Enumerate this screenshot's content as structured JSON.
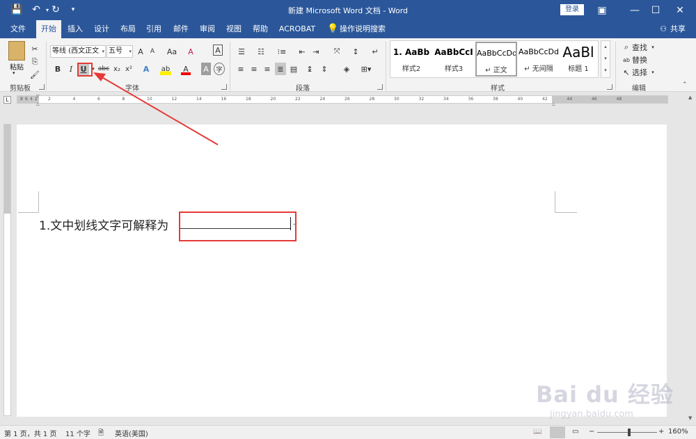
{
  "window": {
    "title": "新建 Microsoft Word 文档  -  Word",
    "login": "登录"
  },
  "tabs": [
    "文件",
    "开始",
    "插入",
    "设计",
    "布局",
    "引用",
    "邮件",
    "审阅",
    "视图",
    "帮助",
    "ACROBAT"
  ],
  "tellme": "操作说明搜索",
  "share": "共享",
  "clipboard": {
    "paste": "粘贴",
    "label": "剪贴板"
  },
  "font": {
    "name": "等线 (西文正文",
    "size": "五号",
    "label": "字体",
    "aa": "Aa",
    "grow": "A",
    "shrink": "A",
    "clear": "A",
    "bold": "B",
    "italic": "I",
    "underline": "U",
    "strike": "abc",
    "sub": "x₂",
    "sup": "x²",
    "effects": "A",
    "highlight": "ab",
    "color": "A",
    "shade": "A",
    "circle": "字"
  },
  "paragraph": {
    "label": "段落"
  },
  "styles": {
    "label": "样式",
    "items": [
      {
        "preview": "1.  AaBb",
        "name": "样式2"
      },
      {
        "preview": "AaBbCcI",
        "name": "样式3"
      },
      {
        "preview": "AaBbCcDd",
        "name": "↵ 正文"
      },
      {
        "preview": "AaBbCcDd",
        "name": "↵ 无间隔"
      },
      {
        "preview": "AaBl",
        "name": "标题 1"
      }
    ]
  },
  "editing": {
    "label": "编辑",
    "find": "查找",
    "replace": "替换",
    "select": "选择"
  },
  "ruler_marks": [
    "8",
    "6",
    "4",
    "2",
    "2",
    "4",
    "6",
    "8",
    "10",
    "12",
    "14",
    "16",
    "18",
    "20",
    "22",
    "24",
    "26",
    "28",
    "30",
    "32",
    "34",
    "36",
    "38",
    "40",
    "42",
    "44",
    "46",
    "48"
  ],
  "doc": {
    "text": "1.文中划线文字可解释为"
  },
  "status": {
    "page": "第 1 页，共 1 页",
    "words": "11 个字",
    "lang": "英语(美国)",
    "zoom": "160%"
  },
  "watermark": {
    "brand": "Bai du 经验",
    "url": "jingyan.baidu.com"
  }
}
